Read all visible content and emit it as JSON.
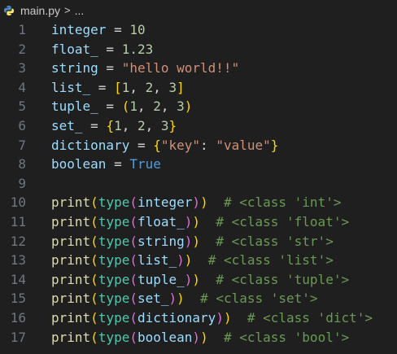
{
  "breadcrumb": {
    "file": "main.py",
    "separator": ">",
    "more": "..."
  },
  "lines": [
    {
      "n": "1",
      "tokens": [
        {
          "t": "integer",
          "c": "var"
        },
        {
          "t": " = ",
          "c": "op"
        },
        {
          "t": "10",
          "c": "num"
        }
      ]
    },
    {
      "n": "2",
      "tokens": [
        {
          "t": "float_",
          "c": "var"
        },
        {
          "t": " = ",
          "c": "op"
        },
        {
          "t": "1.23",
          "c": "num"
        }
      ]
    },
    {
      "n": "3",
      "tokens": [
        {
          "t": "string",
          "c": "var"
        },
        {
          "t": " = ",
          "c": "op"
        },
        {
          "t": "\"hello world!!\"",
          "c": "str"
        }
      ]
    },
    {
      "n": "4",
      "tokens": [
        {
          "t": "list_",
          "c": "var"
        },
        {
          "t": " = ",
          "c": "op"
        },
        {
          "t": "[",
          "c": "b1"
        },
        {
          "t": "1",
          "c": "num"
        },
        {
          "t": ", ",
          "c": "op"
        },
        {
          "t": "2",
          "c": "num"
        },
        {
          "t": ", ",
          "c": "op"
        },
        {
          "t": "3",
          "c": "num"
        },
        {
          "t": "]",
          "c": "b1"
        }
      ]
    },
    {
      "n": "5",
      "tokens": [
        {
          "t": "tuple_",
          "c": "var"
        },
        {
          "t": " = ",
          "c": "op"
        },
        {
          "t": "(",
          "c": "b1"
        },
        {
          "t": "1",
          "c": "num"
        },
        {
          "t": ", ",
          "c": "op"
        },
        {
          "t": "2",
          "c": "num"
        },
        {
          "t": ", ",
          "c": "op"
        },
        {
          "t": "3",
          "c": "num"
        },
        {
          "t": ")",
          "c": "b1"
        }
      ]
    },
    {
      "n": "6",
      "tokens": [
        {
          "t": "set_",
          "c": "var"
        },
        {
          "t": " = ",
          "c": "op"
        },
        {
          "t": "{",
          "c": "b1"
        },
        {
          "t": "1",
          "c": "num"
        },
        {
          "t": ", ",
          "c": "op"
        },
        {
          "t": "2",
          "c": "num"
        },
        {
          "t": ", ",
          "c": "op"
        },
        {
          "t": "3",
          "c": "num"
        },
        {
          "t": "}",
          "c": "b1"
        }
      ]
    },
    {
      "n": "7",
      "tokens": [
        {
          "t": "dictionary",
          "c": "var"
        },
        {
          "t": " = ",
          "c": "op"
        },
        {
          "t": "{",
          "c": "b1"
        },
        {
          "t": "\"key\"",
          "c": "str"
        },
        {
          "t": ": ",
          "c": "op"
        },
        {
          "t": "\"value\"",
          "c": "str"
        },
        {
          "t": "}",
          "c": "b1"
        }
      ]
    },
    {
      "n": "8",
      "tokens": [
        {
          "t": "boolean",
          "c": "var"
        },
        {
          "t": " = ",
          "c": "op"
        },
        {
          "t": "True",
          "c": "kw"
        }
      ]
    },
    {
      "n": "9",
      "tokens": []
    },
    {
      "n": "10",
      "tokens": [
        {
          "t": "print",
          "c": "fn"
        },
        {
          "t": "(",
          "c": "b1"
        },
        {
          "t": "type",
          "c": "cls"
        },
        {
          "t": "(",
          "c": "b2"
        },
        {
          "t": "integer",
          "c": "var"
        },
        {
          "t": ")",
          "c": "b2"
        },
        {
          "t": ")",
          "c": "b1"
        },
        {
          "t": "  # <class 'int'>",
          "c": "cm"
        }
      ]
    },
    {
      "n": "11",
      "tokens": [
        {
          "t": "print",
          "c": "fn"
        },
        {
          "t": "(",
          "c": "b1"
        },
        {
          "t": "type",
          "c": "cls"
        },
        {
          "t": "(",
          "c": "b2"
        },
        {
          "t": "float_",
          "c": "var"
        },
        {
          "t": ")",
          "c": "b2"
        },
        {
          "t": ")",
          "c": "b1"
        },
        {
          "t": "  # <class 'float'>",
          "c": "cm"
        }
      ]
    },
    {
      "n": "12",
      "tokens": [
        {
          "t": "print",
          "c": "fn"
        },
        {
          "t": "(",
          "c": "b1"
        },
        {
          "t": "type",
          "c": "cls"
        },
        {
          "t": "(",
          "c": "b2"
        },
        {
          "t": "string",
          "c": "var"
        },
        {
          "t": ")",
          "c": "b2"
        },
        {
          "t": ")",
          "c": "b1"
        },
        {
          "t": "  # <class 'str'>",
          "c": "cm"
        }
      ]
    },
    {
      "n": "13",
      "tokens": [
        {
          "t": "print",
          "c": "fn"
        },
        {
          "t": "(",
          "c": "b1"
        },
        {
          "t": "type",
          "c": "cls"
        },
        {
          "t": "(",
          "c": "b2"
        },
        {
          "t": "list_",
          "c": "var"
        },
        {
          "t": ")",
          "c": "b2"
        },
        {
          "t": ")",
          "c": "b1"
        },
        {
          "t": "  # <class 'list'>",
          "c": "cm"
        }
      ]
    },
    {
      "n": "14",
      "tokens": [
        {
          "t": "print",
          "c": "fn"
        },
        {
          "t": "(",
          "c": "b1"
        },
        {
          "t": "type",
          "c": "cls"
        },
        {
          "t": "(",
          "c": "b2"
        },
        {
          "t": "tuple_",
          "c": "var"
        },
        {
          "t": ")",
          "c": "b2"
        },
        {
          "t": ")",
          "c": "b1"
        },
        {
          "t": "  # <class 'tuple'>",
          "c": "cm"
        }
      ]
    },
    {
      "n": "15",
      "tokens": [
        {
          "t": "print",
          "c": "fn"
        },
        {
          "t": "(",
          "c": "b1"
        },
        {
          "t": "type",
          "c": "cls"
        },
        {
          "t": "(",
          "c": "b2"
        },
        {
          "t": "set_",
          "c": "var"
        },
        {
          "t": ")",
          "c": "b2"
        },
        {
          "t": ")",
          "c": "b1"
        },
        {
          "t": "  # <class 'set'>",
          "c": "cm"
        }
      ]
    },
    {
      "n": "16",
      "tokens": [
        {
          "t": "print",
          "c": "fn"
        },
        {
          "t": "(",
          "c": "b1"
        },
        {
          "t": "type",
          "c": "cls"
        },
        {
          "t": "(",
          "c": "b2"
        },
        {
          "t": "dictionary",
          "c": "var"
        },
        {
          "t": ")",
          "c": "b2"
        },
        {
          "t": ")",
          "c": "b1"
        },
        {
          "t": "  # <class 'dict'>",
          "c": "cm"
        }
      ]
    },
    {
      "n": "17",
      "tokens": [
        {
          "t": "print",
          "c": "fn"
        },
        {
          "t": "(",
          "c": "b1"
        },
        {
          "t": "type",
          "c": "cls"
        },
        {
          "t": "(",
          "c": "b2"
        },
        {
          "t": "boolean",
          "c": "var"
        },
        {
          "t": ")",
          "c": "b2"
        },
        {
          "t": ")",
          "c": "b1"
        },
        {
          "t": "  # <class 'bool'>",
          "c": "cm"
        }
      ]
    }
  ]
}
